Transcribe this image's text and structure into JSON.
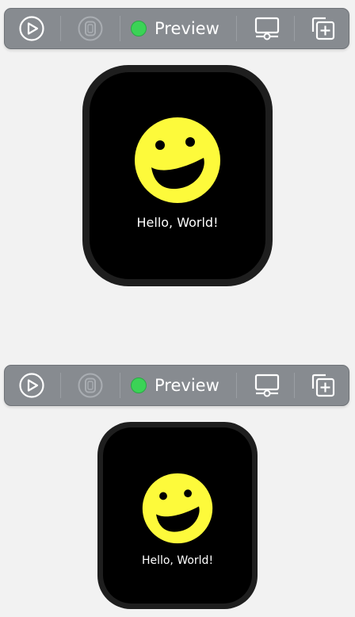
{
  "colors": {
    "toolbar_bg": "#878b90",
    "status_green": "#3bd356",
    "smiley_yellow": "#fdfa3b",
    "watch_case": "#1e1e1e",
    "screen_bg": "#000000"
  },
  "previews": [
    {
      "toolbar": {
        "play_icon": "play-circle-icon",
        "device_icon": "watch-device-icon",
        "status_label": "Preview",
        "settings_icon": "display-settings-icon",
        "duplicate_icon": "duplicate-preview-icon"
      },
      "device": {
        "label": "Hello, World!",
        "emoji": "smiley-face-icon"
      }
    },
    {
      "toolbar": {
        "play_icon": "play-circle-icon",
        "device_icon": "watch-device-icon",
        "status_label": "Preview",
        "settings_icon": "display-settings-icon",
        "duplicate_icon": "duplicate-preview-icon"
      },
      "device": {
        "label": "Hello, World!",
        "emoji": "smiley-face-icon"
      }
    }
  ]
}
